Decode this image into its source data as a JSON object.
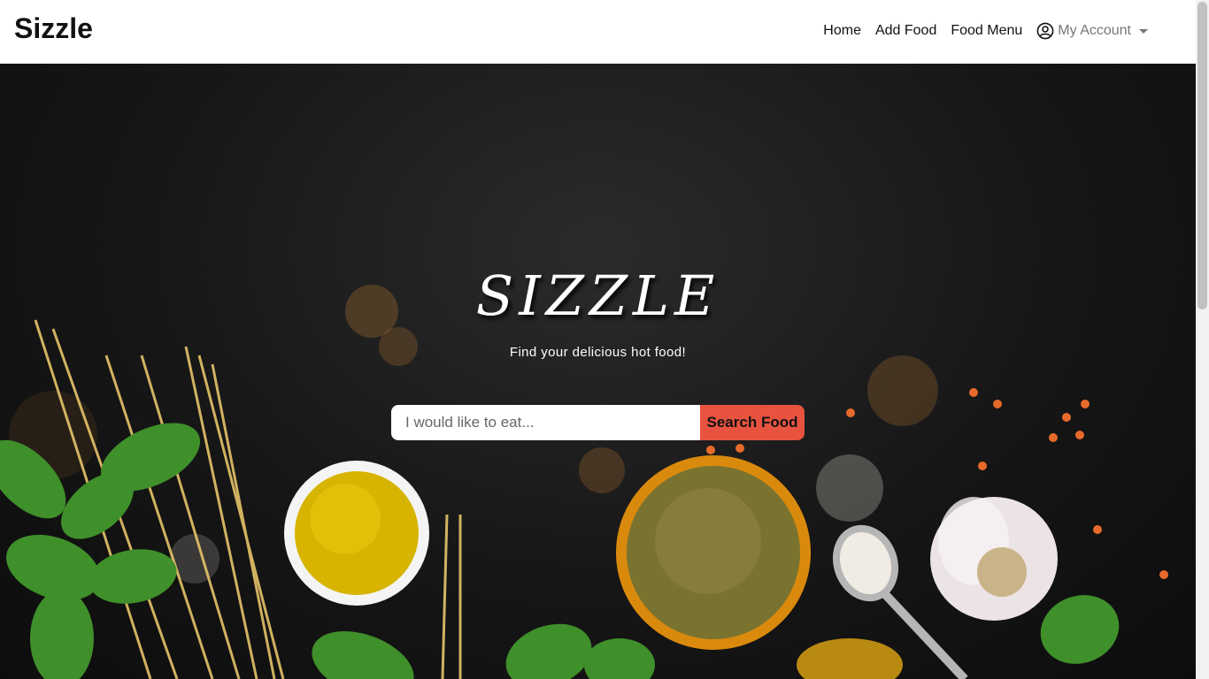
{
  "navbar": {
    "brand": "Sizzle",
    "links": [
      {
        "label": "Home"
      },
      {
        "label": "Add Food"
      },
      {
        "label": "Food Menu"
      }
    ],
    "account_label": "My Account"
  },
  "hero": {
    "title": "SIZZLE",
    "subtitle": "Find your delicious hot food!",
    "search": {
      "placeholder": "I would like to eat...",
      "value": "",
      "button_label": "Search Food"
    }
  },
  "colors": {
    "navbar_bg": "#ffffff",
    "hero_bg": "#161616",
    "search_button": "#e8533f"
  },
  "icons": {
    "account": "user-circle-icon",
    "dropdown": "caret-down-icon"
  }
}
